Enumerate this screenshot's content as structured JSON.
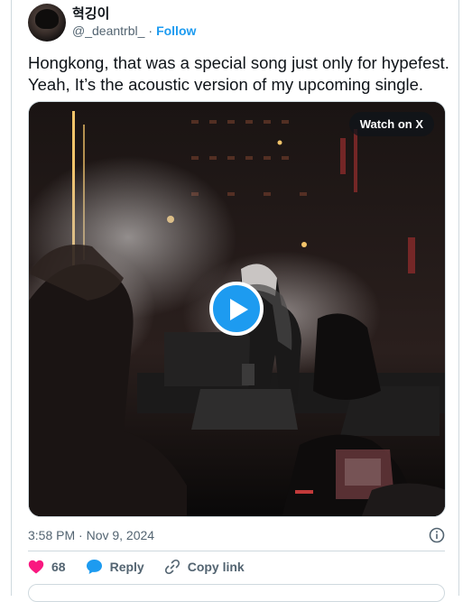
{
  "author": {
    "display_name": "혁깅이",
    "handle": "@_deantrbl_",
    "separator": "·",
    "follow_label": "Follow"
  },
  "tweet": {
    "lines": [
      "Hongkong, that was a special song just only for hypefest.",
      "Yeah, It’s the acoustic version of my upcoming single."
    ]
  },
  "media": {
    "watch_label": "Watch on X"
  },
  "meta": {
    "timestamp": "3:58 PM · Nov 9, 2024"
  },
  "actions": {
    "like_count": "68",
    "reply_label": "Reply",
    "copy_link_label": "Copy link"
  },
  "colors": {
    "accent": "#1d9bf0",
    "like": "#f91880",
    "secondary_text": "#536471",
    "border": "#cfd9de"
  }
}
